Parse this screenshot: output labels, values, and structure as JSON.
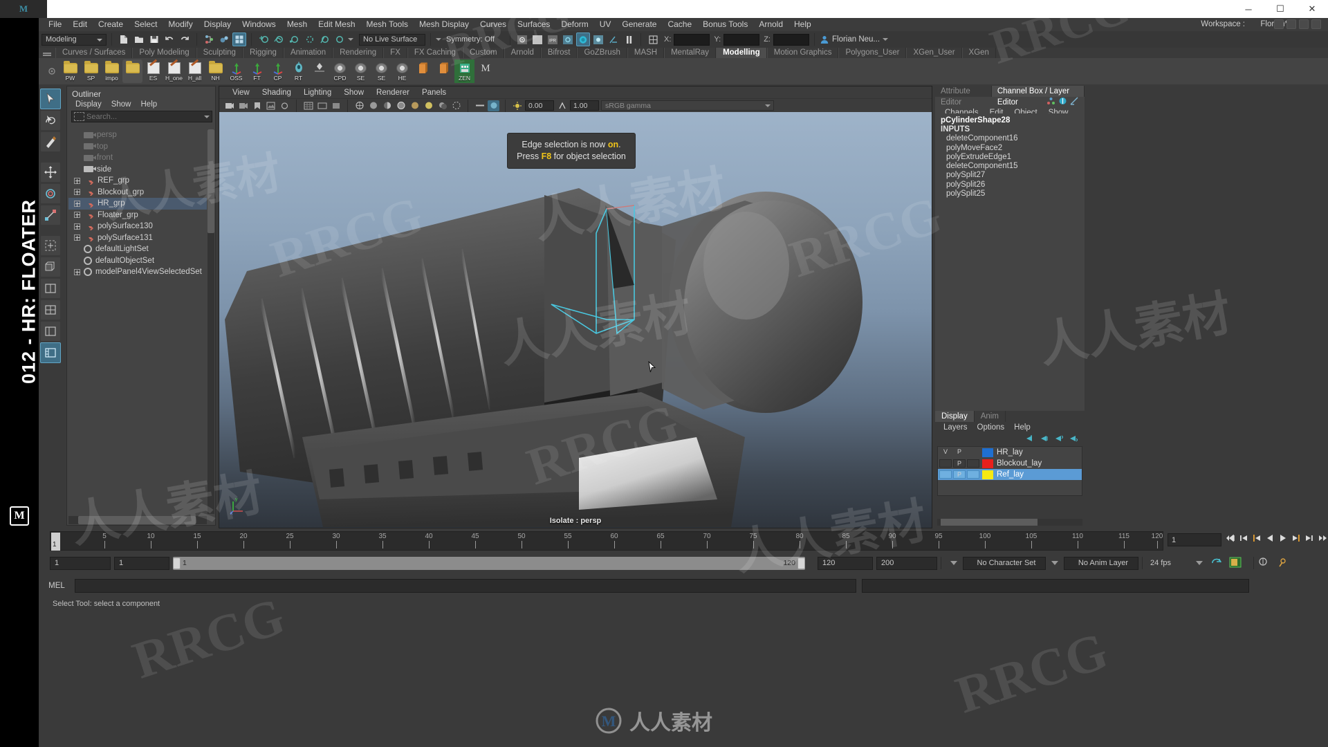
{
  "app": {
    "vertical_banner": "012 - HR: FLOATER",
    "logo": "M"
  },
  "titlebar": {
    "minimize": "─",
    "maximize": "☐",
    "close": "✕"
  },
  "menubar": {
    "items": [
      "File",
      "Edit",
      "Create",
      "Select",
      "Modify",
      "Display",
      "Windows",
      "Mesh",
      "Edit Mesh",
      "Mesh Tools",
      "Mesh Display",
      "Curves",
      "Surfaces",
      "Deform",
      "UV",
      "Generate",
      "Cache",
      "Bonus Tools",
      "Arnold",
      "Help"
    ],
    "workspace_label": "Workspace :",
    "workspace_value": "Florian*"
  },
  "statusbar": {
    "menuset": "Modeling",
    "live_surface": "No Live Surface",
    "symmetry": "Symmetry: Off",
    "coord_x": "X:",
    "coord_y": "Y:",
    "coord_z": "Z:",
    "coord_x_value": "",
    "coord_y_value": "",
    "coord_z_value": "",
    "user": "Florian Neu..."
  },
  "shelf": {
    "tabs": [
      "Curves / Surfaces",
      "Poly Modeling",
      "Sculpting",
      "Rigging",
      "Animation",
      "Rendering",
      "FX",
      "FX Caching",
      "Custom",
      "Arnold",
      "Bifrost",
      "GoZBrush",
      "MASH",
      "MentalRay",
      "Modelling",
      "Motion Graphics",
      "Polygons_User",
      "XGen_User",
      "XGen"
    ],
    "active_tab": "Modelling",
    "buttons": [
      {
        "label": "PW",
        "icon": "folder-icon"
      },
      {
        "label": "SP",
        "icon": "folder-icon"
      },
      {
        "label": "impo",
        "icon": "folder-icon"
      },
      {
        "label": "",
        "icon": "folder-icon"
      },
      {
        "label": "ES",
        "icon": "pencil-icon"
      },
      {
        "label": "H_one",
        "icon": "pencil-icon"
      },
      {
        "label": "H_all",
        "icon": "pencil-icon"
      },
      {
        "label": "NH",
        "icon": "folder-icon"
      },
      {
        "label": "OSS",
        "icon": "axis-icon"
      },
      {
        "label": "FT",
        "icon": "axis-icon"
      },
      {
        "label": "CP",
        "icon": "axis-icon"
      },
      {
        "label": "RT",
        "icon": "robot-icon"
      },
      {
        "label": "",
        "icon": "diamond-icon"
      },
      {
        "label": "CPD",
        "icon": "eye-icon"
      },
      {
        "label": "SE",
        "icon": "eye-icon"
      },
      {
        "label": "SE",
        "icon": "eye-icon"
      },
      {
        "label": "HE",
        "icon": "eye-icon"
      },
      {
        "label": "",
        "icon": "box-icon"
      },
      {
        "label": "",
        "icon": "box-icon"
      },
      {
        "label": "ZEN",
        "icon": "zen-icon"
      },
      {
        "label": "",
        "icon": "maya-icon"
      }
    ]
  },
  "toolbox": {
    "tools": [
      "select-tool",
      "lasso-tool",
      "paint-select-tool",
      "move-tool",
      "rotate-tool",
      "scale-tool",
      "last-tool",
      "snap-grid",
      "snap-curve",
      "snap-point",
      "show-manipulator",
      "component-editor"
    ]
  },
  "outliner": {
    "title": "Outliner",
    "menu": [
      "Display",
      "Show",
      "Help"
    ],
    "search_placeholder": "Search...",
    "search_value": "",
    "items": [
      {
        "label": "persp",
        "icon": "camera-icon",
        "indent": 1,
        "dim": true,
        "expandable": false,
        "selected": false
      },
      {
        "label": "top",
        "icon": "camera-icon",
        "indent": 1,
        "dim": true,
        "expandable": false,
        "selected": false
      },
      {
        "label": "front",
        "icon": "camera-icon",
        "indent": 1,
        "dim": true,
        "expandable": false,
        "selected": false
      },
      {
        "label": "side",
        "icon": "camera-icon",
        "indent": 1,
        "dim": false,
        "expandable": false,
        "selected": false
      },
      {
        "label": "REF_grp",
        "icon": "group-icon",
        "indent": 0,
        "dim": false,
        "expandable": true,
        "selected": false
      },
      {
        "label": "Blockout_grp",
        "icon": "group-icon",
        "indent": 0,
        "dim": false,
        "expandable": true,
        "selected": false
      },
      {
        "label": "HR_grp",
        "icon": "group-icon",
        "indent": 0,
        "dim": false,
        "expandable": true,
        "selected": true
      },
      {
        "label": "Floater_grp",
        "icon": "group-icon",
        "indent": 0,
        "dim": false,
        "expandable": true,
        "selected": false
      },
      {
        "label": "polySurface130",
        "icon": "group-icon",
        "indent": 0,
        "dim": false,
        "expandable": true,
        "selected": false
      },
      {
        "label": "polySurface131",
        "icon": "group-icon",
        "indent": 0,
        "dim": false,
        "expandable": true,
        "selected": false
      },
      {
        "label": "defaultLightSet",
        "icon": "set-icon",
        "indent": 1,
        "dim": false,
        "expandable": false,
        "selected": false
      },
      {
        "label": "defaultObjectSet",
        "icon": "set-icon",
        "indent": 1,
        "dim": false,
        "expandable": false,
        "selected": false
      },
      {
        "label": "modelPanel4ViewSelectedSet",
        "icon": "set-icon",
        "indent": 0,
        "dim": false,
        "expandable": true,
        "selected": false
      }
    ]
  },
  "viewport": {
    "menu": [
      "View",
      "Shading",
      "Lighting",
      "Show",
      "Renderer",
      "Panels"
    ],
    "exposure": "0.00",
    "gamma": "1.00",
    "color_space": "sRGB gamma",
    "tooltip_line1_a": "Edge selection is now ",
    "tooltip_line1_b": "on",
    "tooltip_line1_c": ".",
    "tooltip_line2_a": "Press ",
    "tooltip_line2_b": "F8",
    "tooltip_line2_c": " for object selection",
    "footer_label": "Isolate : persp",
    "axis_x": "x",
    "axis_y": "y"
  },
  "rightpanel": {
    "tabs": [
      "Attribute Editor",
      "Channel Box / Layer Editor"
    ],
    "active_tab": "Channel Box / Layer Editor",
    "channelbox": {
      "menu": [
        "Channels",
        "Edit",
        "Object",
        "Show"
      ],
      "shape_name": "pCylinderShape28",
      "inputs_label": "INPUTS",
      "inputs": [
        "deleteComponent16",
        "polyMoveFace2",
        "polyExtrudeEdge1",
        "deleteComponent15",
        "polySplit27",
        "polySplit26",
        "polySplit25"
      ]
    },
    "layereditor": {
      "tabs": [
        "Display",
        "Anim"
      ],
      "active_tab": "Display",
      "menu": [
        "Layers",
        "Options",
        "Help"
      ],
      "col_v": "V",
      "col_p": "P",
      "layers": [
        {
          "name": "HR_lay",
          "color": "#1f6fd0",
          "visible": "V",
          "playback": "P",
          "selected": false
        },
        {
          "name": "Blockout_lay",
          "color": "#e8201c",
          "visible": "",
          "playback": "P",
          "selected": false
        },
        {
          "name": "Ref_lay",
          "color": "#f5e913",
          "visible": "",
          "playback": "P",
          "selected": true
        }
      ]
    }
  },
  "timeline": {
    "ticks": [
      5,
      10,
      15,
      20,
      25,
      30,
      35,
      40,
      45,
      50,
      55,
      60,
      65,
      70,
      75,
      80,
      85,
      90,
      95,
      100,
      105,
      110,
      115,
      120
    ],
    "current_frame": "1",
    "current_frame_field": "1",
    "playback_buttons": [
      "go-to-start",
      "step-back-key",
      "step-back-frame",
      "play-backwards",
      "play-forwards",
      "step-forward-frame",
      "step-forward-key",
      "go-to-end"
    ]
  },
  "rangeslider": {
    "start_field": "1",
    "range_start_field": "1",
    "bar_start": "1",
    "bar_end": "120",
    "range_end_field": "120",
    "end_field": "200",
    "character_set": "No Character Set",
    "anim_layer": "No Anim Layer",
    "fps": "24 fps"
  },
  "commandline": {
    "mode_label": "MEL",
    "input_value": ""
  },
  "statusline": {
    "text": "Select Tool: select a component"
  },
  "watermarks": {
    "rrcg": "RRCG",
    "cn": "人人素材"
  }
}
